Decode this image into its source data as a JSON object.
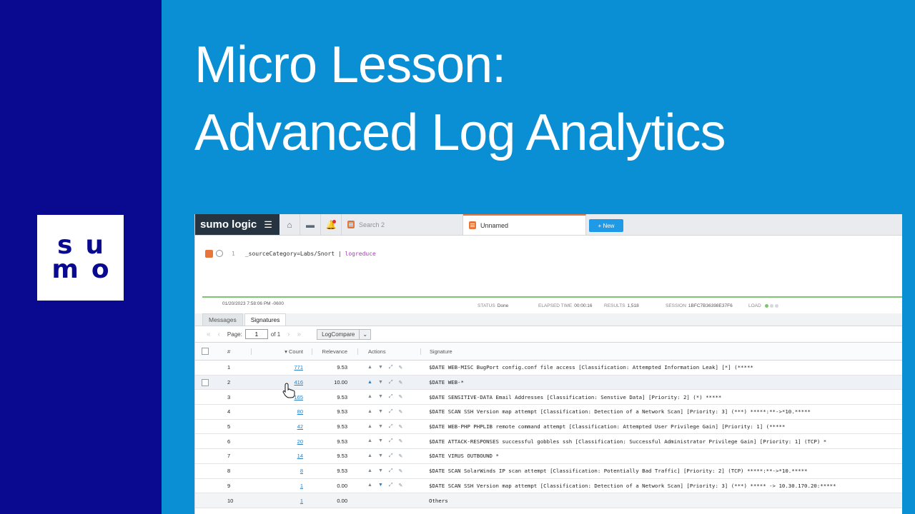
{
  "headline": {
    "line1": "Micro Lesson:",
    "line2": "Advanced Log Analytics"
  },
  "logo": {
    "line1": "su",
    "line2": "mo"
  },
  "app": {
    "brand": "sumo logic",
    "tabs": [
      {
        "label": "Search 2"
      },
      {
        "label": "Unnamed"
      }
    ],
    "new_button": "+ New",
    "query": {
      "line_number": "1",
      "text": "_sourceCategory=Labs/Snort | ",
      "keyword": "logreduce"
    },
    "status": {
      "timestamp": "01/20/2023 7:58:06 PM -0600",
      "status_label": "STATUS",
      "status_value": "Done",
      "elapsed_label": "ELAPSED TIME",
      "elapsed_value": "00:00:16",
      "results_label": "RESULTS",
      "results_value": "1,518",
      "session_label": "SESSION",
      "session_value": "1BFC7B36398E37F6",
      "load_label": "LOAD"
    },
    "result_tabs": [
      "Messages",
      "Signatures"
    ],
    "pager": {
      "page_label": "Page:",
      "page_value": "1",
      "of_label": "of 1",
      "compare_button": "LogCompare"
    },
    "columns": {
      "num": "#",
      "count": "Count",
      "relevance": "Relevance",
      "actions": "Actions",
      "signature": "Signature"
    },
    "rows": [
      {
        "num": "1",
        "count": "771",
        "relevance": "9.53",
        "signature": "$DATE WEB-MISC BugPort config.conf file access [Classification: Attempted Information Leak] [*] (*****"
      },
      {
        "num": "2",
        "count": "416",
        "relevance": "10.00",
        "signature": "$DATE WEB-*"
      },
      {
        "num": "3",
        "count": "165",
        "relevance": "9.53",
        "signature": "$DATE SENSITIVE-DATA Email Addresses [Classification: Senstive Data] [Priority: 2] (*) *****"
      },
      {
        "num": "4",
        "count": "80",
        "relevance": "9.53",
        "signature": "$DATE SCAN SSH Version map attempt [Classification: Detection of a Network Scan] [Priority: 3] (***) *****:**->*10.*****"
      },
      {
        "num": "5",
        "count": "42",
        "relevance": "9.53",
        "signature": "$DATE WEB-PHP PHPLIB remote command attempt [Classification: Attempted User Privilege Gain] [Priority: 1] (*****"
      },
      {
        "num": "6",
        "count": "20",
        "relevance": "9.53",
        "signature": "$DATE ATTACK-RESPONSES successful gobbles ssh [Classification: Successful Administrator Privilege Gain] [Priority: 1] (TCP) *"
      },
      {
        "num": "7",
        "count": "14",
        "relevance": "9.53",
        "signature": "$DATE VIRUS OUTBOUND *"
      },
      {
        "num": "8",
        "count": "8",
        "relevance": "9.53",
        "signature": "$DATE SCAN SolarWinds IP scan attempt [Classification: Potentially Bad Traffic] [Priority: 2] (TCP) *****:**->*10.*****"
      },
      {
        "num": "9",
        "count": "1",
        "relevance": "0.00",
        "signature": "$DATE SCAN SSH Version map attempt [Classification: Detection of a Network Scan] [Priority: 3] (***) ***** -> 10.30.170.20:*****"
      },
      {
        "num": "10",
        "count": "1",
        "relevance": "0.00",
        "signature": "Others"
      }
    ]
  },
  "colors": {
    "left_band": "#0a0a91",
    "right_band": "#0a8fd4",
    "accent_orange": "#e8763a",
    "link_blue": "#2a7fc4",
    "status_green": "#7cc46f"
  }
}
